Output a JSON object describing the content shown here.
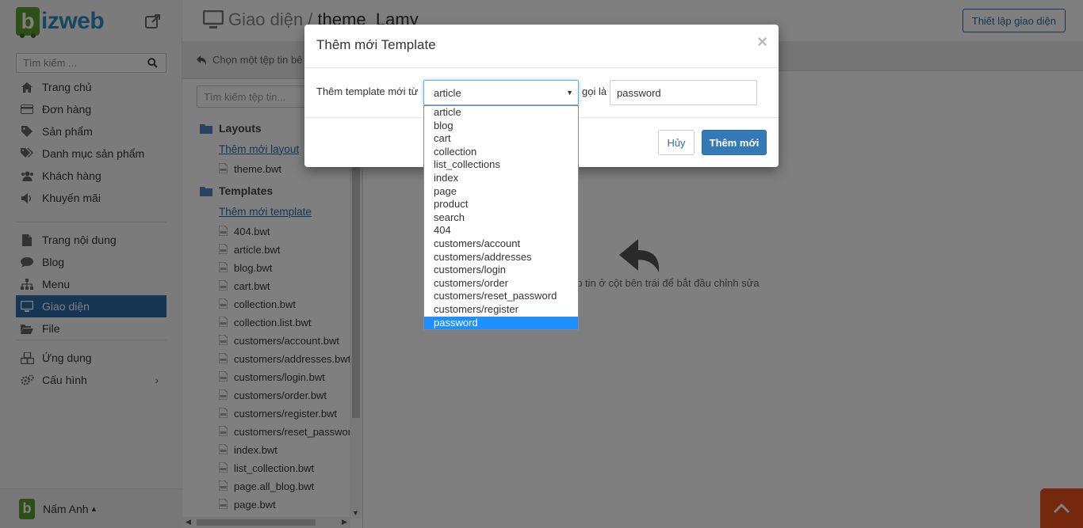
{
  "app": {
    "logo_letter": "b",
    "logo_text": "izweb"
  },
  "sidebar": {
    "search_placeholder": "Tìm kiếm ...",
    "group1": [
      {
        "label": "Trang chủ",
        "icon": "home-icon"
      },
      {
        "label": "Đơn hàng",
        "icon": "credit-card-icon"
      },
      {
        "label": "Sản phẩm",
        "icon": "tag-icon"
      },
      {
        "label": "Danh mục sản phẩm",
        "icon": "tags-icon"
      },
      {
        "label": "Khách hàng",
        "icon": "users-icon"
      },
      {
        "label": "Khuyến mãi",
        "icon": "megaphone-icon"
      }
    ],
    "group2": [
      {
        "label": "Trang nội dung",
        "icon": "file-icon"
      },
      {
        "label": "Blog",
        "icon": "comment-icon"
      },
      {
        "label": "Menu",
        "icon": "sitemap-icon"
      },
      {
        "label": "Giao diện",
        "icon": "desktop-icon",
        "active": true
      },
      {
        "label": "File",
        "icon": "folder-open-icon"
      }
    ],
    "group3": [
      {
        "label": "Ứng dụng",
        "icon": "cubes-icon"
      },
      {
        "label": "Cấu hình",
        "icon": "gears-icon"
      }
    ],
    "user_name": "Nấm Anh",
    "user_caret": "▴",
    "config_chevron": "›"
  },
  "header": {
    "title_prefix": "Giao diện / ",
    "title_theme": "theme_Lamy",
    "setup_button": "Thiết lập giao diện"
  },
  "file_panel": {
    "hint": "Chọn một tệp tin bê",
    "search_placeholder": "Tìm kiếm tệp tin...",
    "layouts_label": "Layouts",
    "add_layout": "Thêm mới layout",
    "layout_files": [
      "theme.bwt"
    ],
    "templates_label": "Templates",
    "add_template": "Thêm mới template",
    "template_files": [
      "404.bwt",
      "article.bwt",
      "blog.bwt",
      "cart.bwt",
      "collection.bwt",
      "collection.list.bwt",
      "customers/account.bwt",
      "customers/addresses.bwt",
      "customers/login.bwt",
      "customers/order.bwt",
      "customers/register.bwt",
      "customers/reset_password.bwt",
      "index.bwt",
      "list_collection.bwt",
      "page.all_blog.bwt",
      "page.bwt"
    ]
  },
  "editor": {
    "empty_message": "Chọn một tệp tin ở cột bên trái để bắt đầu chỉnh sửa"
  },
  "modal": {
    "title": "Thêm mới Template",
    "close": "×",
    "from_label": "Thêm template mới từ",
    "selected": "article",
    "named_label": "gọi là",
    "name_value": "password",
    "cancel": "Hủy",
    "submit": "Thêm mới",
    "options": [
      "article",
      "blog",
      "cart",
      "collection",
      "list_collections",
      "index",
      "page",
      "product",
      "search",
      "404",
      "customers/account",
      "customers/addresses",
      "customers/login",
      "customers/order",
      "customers/reset_password",
      "customers/register",
      "password"
    ],
    "highlighted_option": "password"
  },
  "colors": {
    "brand_green": "#5aa02c",
    "brand_blue": "#2c6ca8",
    "primary_button": "#337ab7",
    "chat_orange": "#e8521c",
    "highlight": "#1e90ff"
  }
}
